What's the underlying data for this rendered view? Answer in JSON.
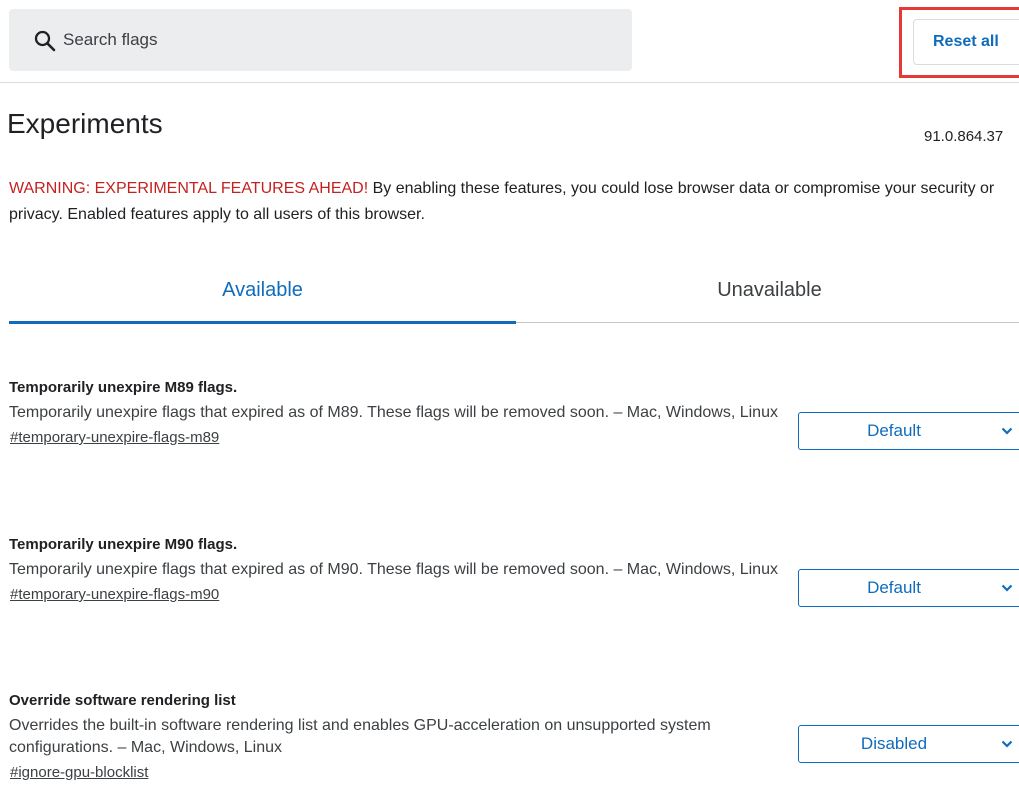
{
  "search": {
    "placeholder": "Search flags",
    "value": ""
  },
  "header": {
    "reset_label": "Reset all"
  },
  "page": {
    "title": "Experiments",
    "version": "91.0.864.37"
  },
  "warning": {
    "label": "WARNING: EXPERIMENTAL FEATURES AHEAD!",
    "text": " By enabling these features, you could lose browser data or compromise your security or privacy. Enabled features apply to all users of this browser."
  },
  "tabs": [
    {
      "label": "Available",
      "active": true
    },
    {
      "label": "Unavailable",
      "active": false
    }
  ],
  "flags": [
    {
      "name": "Temporarily unexpire M89 flags.",
      "description": "Temporarily unexpire flags that expired as of M89. These flags will be removed soon. – Mac, Windows, Linux",
      "link": "#temporary-unexpire-flags-m89",
      "value": "Default"
    },
    {
      "name": "Temporarily unexpire M90 flags.",
      "description": "Temporarily unexpire flags that expired as of M90. These flags will be removed soon. – Mac, Windows, Linux",
      "link": "#temporary-unexpire-flags-m90",
      "value": "Default"
    },
    {
      "name": "Override software rendering list",
      "description": "Overrides the built-in software rendering list and enables GPU-acceleration on unsupported system configurations. – Mac, Windows, Linux",
      "link": "#ignore-gpu-blocklist",
      "value": "Disabled"
    }
  ],
  "colors": {
    "accent": "#0f6cbd",
    "warning": "#c5221f",
    "highlight": "#e53935",
    "search_bg": "#ecedef"
  },
  "icons": {
    "search": "search-icon",
    "dropdown": "chevron-down-icon"
  }
}
